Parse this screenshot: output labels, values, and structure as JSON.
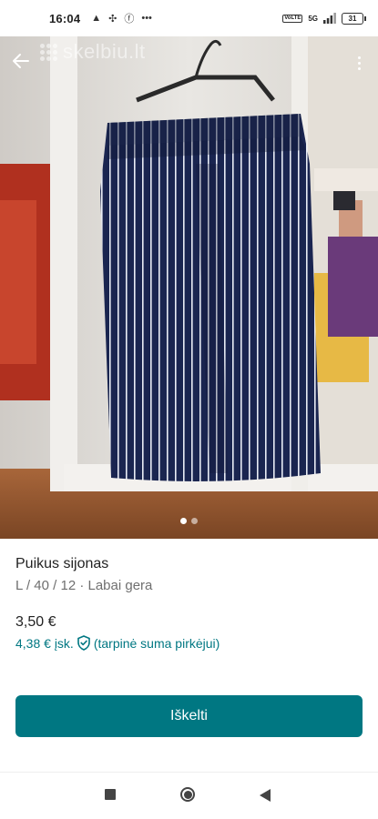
{
  "status_bar": {
    "time": "16:04",
    "network_badge": "VoLTE",
    "network_type": "5G",
    "battery": "31"
  },
  "photo": {
    "watermark": "skelbiu.lt",
    "image_count": 2,
    "active_index": 0
  },
  "item": {
    "title": "Puikus sijonas",
    "meta": "L / 40 / 12 · Labai gera",
    "price": "3,50 €",
    "buyer_price": "4,38 € įsk.",
    "buyer_note": "(tarpinė suma pirkėjui)"
  },
  "actions": {
    "bump_label": "Iškelti"
  },
  "colors": {
    "accent": "#007782",
    "skirt": "#1a2550",
    "stripe": "#e8ecf5"
  },
  "icons": {
    "back": "arrow-left-icon",
    "more": "more-vertical-icon",
    "shield": "shield-check-icon",
    "nav_recent": "square-icon",
    "nav_home": "circle-icon",
    "nav_back": "triangle-back-icon"
  }
}
